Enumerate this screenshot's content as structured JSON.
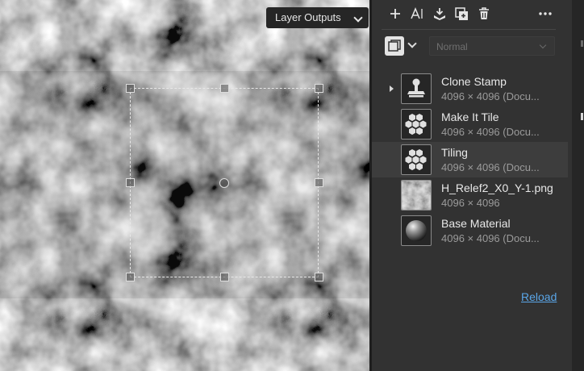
{
  "viewport": {
    "output_menu_label": "Layer Outputs"
  },
  "toolbar": {
    "buttons": [
      "add-icon",
      "text-layer-icon",
      "merge-down-icon",
      "duplicate-icon",
      "trash-icon",
      "more-icon"
    ]
  },
  "blend": {
    "mode_value": "Normal"
  },
  "layers": [
    {
      "name": "Clone Stamp",
      "info": "4096 × 4096 (Docu...",
      "icon": "clone-stamp-icon",
      "expandable": true,
      "selected": false
    },
    {
      "name": "Make It Tile",
      "info": "4096 × 4096 (Docu...",
      "icon": "hexagon-tile-icon",
      "expandable": false,
      "selected": false
    },
    {
      "name": "Tiling",
      "info": "4096 × 4096 (Docu...",
      "icon": "hexagon-tile-icon",
      "expandable": false,
      "selected": true
    },
    {
      "name": "H_Relef2_X0_Y-1.png",
      "info": "4096 × 4096",
      "icon": "image-thumbnail",
      "expandable": false,
      "selected": false
    },
    {
      "name": "Base Material",
      "info": "4096 × 4096 (Docu...",
      "icon": "sphere-icon",
      "expandable": false,
      "selected": false
    }
  ],
  "footer": {
    "reload_label": "Reload"
  },
  "colors": {
    "panel_bg": "#323232",
    "selected_row": "#3d3d3d",
    "link": "#5aa6e8"
  }
}
